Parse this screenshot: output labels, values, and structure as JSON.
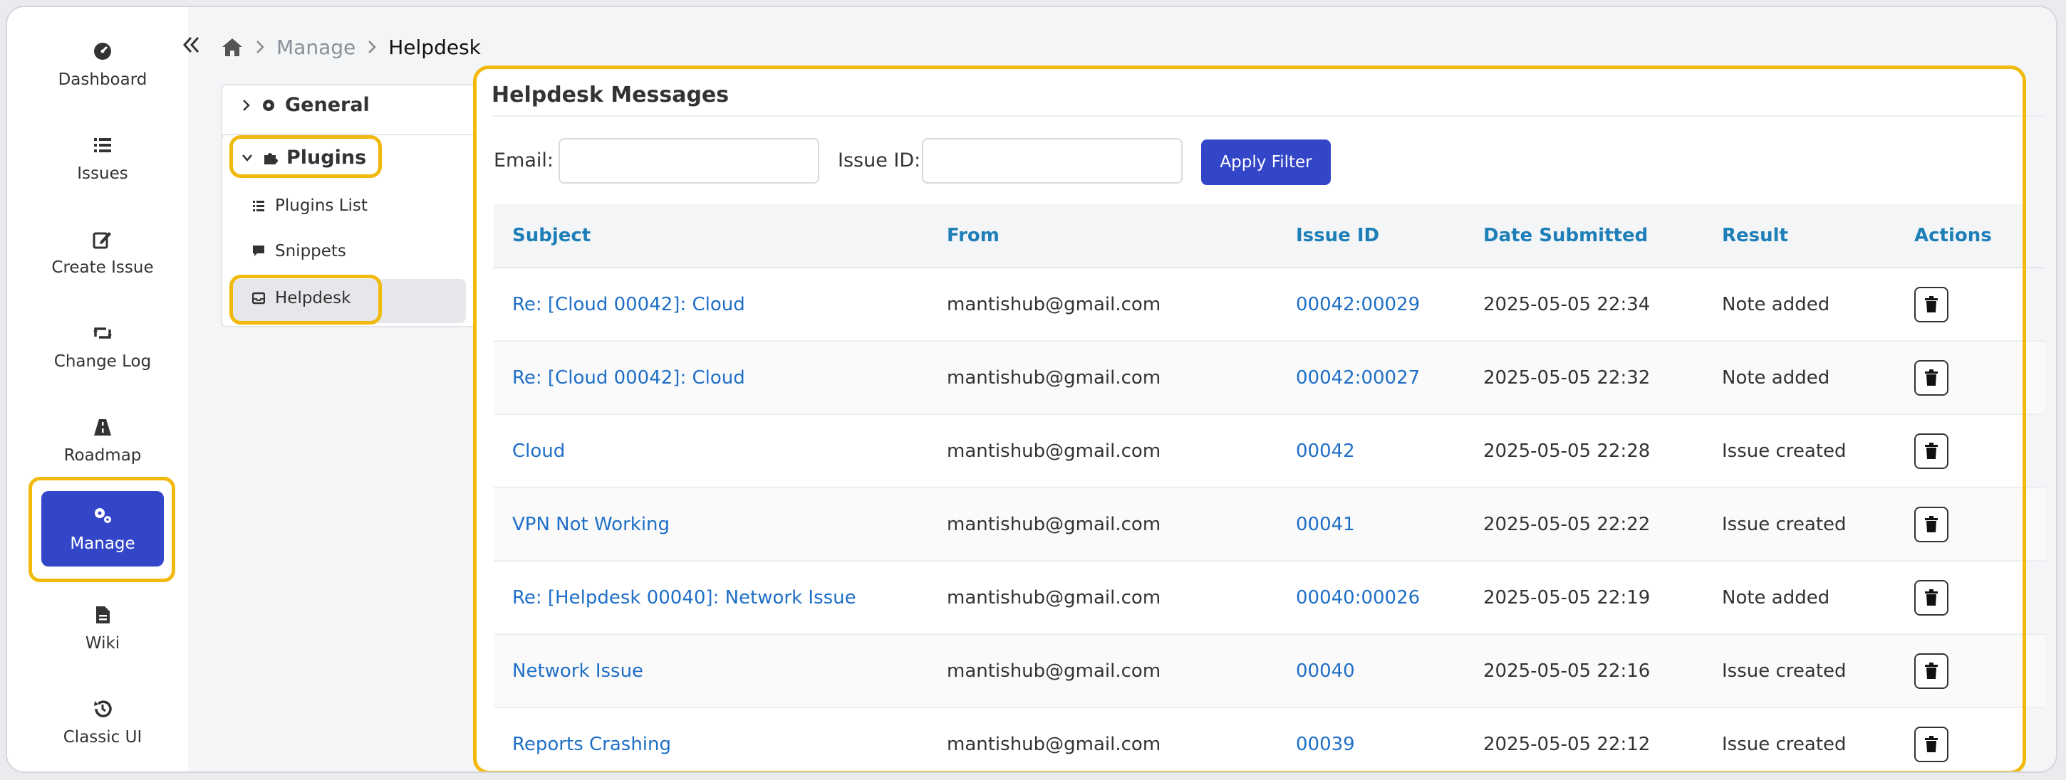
{
  "sidebar": {
    "items": [
      {
        "label": "Dashboard",
        "icon": "dashboard-icon"
      },
      {
        "label": "Issues",
        "icon": "list-icon"
      },
      {
        "label": "Create Issue",
        "icon": "edit-icon"
      },
      {
        "label": "Change Log",
        "icon": "retweet-icon"
      },
      {
        "label": "Roadmap",
        "icon": "road-icon"
      },
      {
        "label": "Manage",
        "icon": "cogs-icon",
        "active": true
      },
      {
        "label": "Wiki",
        "icon": "file-icon"
      },
      {
        "label": "Classic UI",
        "icon": "history-icon"
      }
    ]
  },
  "breadcrumb": {
    "home_icon": "home-icon",
    "items": [
      "Manage",
      "Helpdesk"
    ]
  },
  "settings_menu": {
    "general": "General",
    "plugins": "Plugins",
    "sub_items": [
      "Plugins List",
      "Snippets",
      "Helpdesk"
    ]
  },
  "panel": {
    "title": "Helpdesk Messages",
    "filter": {
      "email_label": "Email:",
      "email_value": "",
      "issue_label": "Issue ID:",
      "issue_value": "",
      "apply_label": "Apply Filter"
    },
    "columns": [
      "Subject",
      "From",
      "Issue ID",
      "Date Submitted",
      "Result",
      "Actions"
    ],
    "rows": [
      {
        "subject": "Re: [Cloud 00042]: Cloud",
        "from": "mantishub@gmail.com",
        "issue_id": "00042:00029",
        "date": "2025-05-05 22:34",
        "result": "Note added"
      },
      {
        "subject": "Re: [Cloud 00042]: Cloud",
        "from": "mantishub@gmail.com",
        "issue_id": "00042:00027",
        "date": "2025-05-05 22:32",
        "result": "Note added"
      },
      {
        "subject": "Cloud",
        "from": "mantishub@gmail.com",
        "issue_id": "00042",
        "date": "2025-05-05 22:28",
        "result": "Issue created"
      },
      {
        "subject": "VPN Not Working",
        "from": "mantishub@gmail.com",
        "issue_id": "00041",
        "date": "2025-05-05 22:22",
        "result": "Issue created"
      },
      {
        "subject": "Re: [Helpdesk 00040]: Network Issue",
        "from": "mantishub@gmail.com",
        "issue_id": "00040:00026",
        "date": "2025-05-05 22:19",
        "result": "Note added"
      },
      {
        "subject": "Network Issue",
        "from": "mantishub@gmail.com",
        "issue_id": "00040",
        "date": "2025-05-05 22:16",
        "result": "Issue created"
      },
      {
        "subject": "Reports Crashing",
        "from": "mantishub@gmail.com",
        "issue_id": "00039",
        "date": "2025-05-05 22:12",
        "result": "Issue created"
      }
    ]
  },
  "colors": {
    "accent": "#3346c8",
    "highlight": "#f2b90d",
    "link": "#1f6fc7",
    "header_text": "#1e7fb8"
  }
}
